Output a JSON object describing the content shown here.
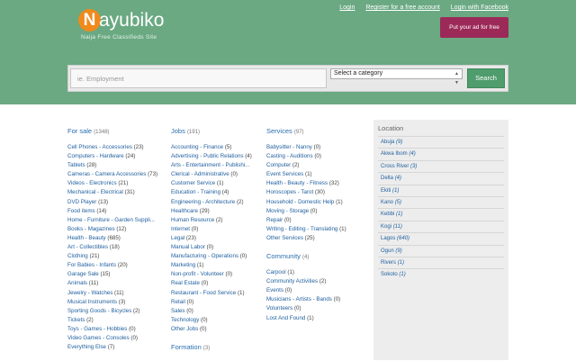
{
  "brand": {
    "initial": "N",
    "rest": "ayubiko",
    "tagline": "Naija Free Classifieds Site"
  },
  "top_links": {
    "login": "Login",
    "register": "Register for a free account",
    "facebook": "Login with Facebook"
  },
  "post_ad": "Put your ad for free",
  "search": {
    "placeholder": "ie. Employment",
    "category_value": "Select a category",
    "button": "Search"
  },
  "columns": [
    [
      {
        "title": "For sale",
        "count": "(1348)",
        "items": [
          {
            "name": "Cell Phones - Accessories",
            "count": "(23)"
          },
          {
            "name": "Computers - Hardware",
            "count": "(24)"
          },
          {
            "name": "Tablets",
            "count": "(28)"
          },
          {
            "name": "Cameras - Camera Accessories",
            "count": "(73)"
          },
          {
            "name": "Videos - Electronics",
            "count": "(21)"
          },
          {
            "name": "Mechanical - Electrical",
            "count": "(31)"
          },
          {
            "name": "DVD Player",
            "count": "(13)"
          },
          {
            "name": "Food items",
            "count": "(14)"
          },
          {
            "name": "Home - Furniture - Garden Suppli...",
            "count": ""
          },
          {
            "name": "Books - Magazines",
            "count": "(12)"
          },
          {
            "name": "Health - Beauty",
            "count": "(685)"
          },
          {
            "name": "Art - Collectibles",
            "count": "(18)"
          },
          {
            "name": "Clothing",
            "count": "(21)"
          },
          {
            "name": "For Babies - Infants",
            "count": "(20)"
          },
          {
            "name": "Garage Sale",
            "count": "(15)"
          },
          {
            "name": "Animals",
            "count": "(11)"
          },
          {
            "name": "Jewelry - Watches",
            "count": "(11)"
          },
          {
            "name": "Musical Instruments",
            "count": "(3)"
          },
          {
            "name": "Sporting Goods - Bicycles",
            "count": "(2)"
          },
          {
            "name": "Tickets",
            "count": "(2)"
          },
          {
            "name": "Toys - Games - Hobbies",
            "count": "(0)"
          },
          {
            "name": "Video Games - Consoles",
            "count": "(0)"
          },
          {
            "name": "Everything Else",
            "count": "(7)"
          }
        ]
      }
    ],
    [
      {
        "title": "Jobs",
        "count": "(191)",
        "items": [
          {
            "name": "Accounting - Finance",
            "count": "(5)"
          },
          {
            "name": "Advertising - Public Relations",
            "count": "(4)"
          },
          {
            "name": "Arts - Entertainment - Publishi...",
            "count": ""
          },
          {
            "name": "Clerical - Administrative",
            "count": "(0)"
          },
          {
            "name": "Customer Service",
            "count": "(1)"
          },
          {
            "name": "Education - Training",
            "count": "(4)"
          },
          {
            "name": "Engineering - Architecture",
            "count": "(2)"
          },
          {
            "name": "Healthcare",
            "count": "(29)"
          },
          {
            "name": "Human Resource",
            "count": "(2)"
          },
          {
            "name": "Internet",
            "count": "(0)"
          },
          {
            "name": "Legal",
            "count": "(23)"
          },
          {
            "name": "Manual Labor",
            "count": "(0)"
          },
          {
            "name": "Manufacturing - Operations",
            "count": "(0)"
          },
          {
            "name": "Marketing",
            "count": "(1)"
          },
          {
            "name": "Non-profit - Volunteer",
            "count": "(0)"
          },
          {
            "name": "Real Estate",
            "count": "(0)"
          },
          {
            "name": "Restaurant - Food Service",
            "count": "(1)"
          },
          {
            "name": "Retail",
            "count": "(0)"
          },
          {
            "name": "Sales",
            "count": "(0)"
          },
          {
            "name": "Technology",
            "count": "(0)"
          },
          {
            "name": "Other Jobs",
            "count": "(0)"
          }
        ]
      },
      {
        "title": "Formation",
        "count": "(3)",
        "items": []
      }
    ],
    [
      {
        "title": "Services",
        "count": "(97)",
        "items": [
          {
            "name": "Babysitter - Nanny",
            "count": "(0)"
          },
          {
            "name": "Casting - Auditions",
            "count": "(0)"
          },
          {
            "name": "Computer",
            "count": "(2)"
          },
          {
            "name": "Event Services",
            "count": "(1)"
          },
          {
            "name": "Health - Beauty - Fitness",
            "count": "(32)"
          },
          {
            "name": "Horoscopes - Tarot",
            "count": "(30)"
          },
          {
            "name": "Household - Domestic Help",
            "count": "(1)"
          },
          {
            "name": "Moving - Storage",
            "count": "(0)"
          },
          {
            "name": "Repair",
            "count": "(0)"
          },
          {
            "name": "Writing - Editing - Translating",
            "count": "(1)"
          },
          {
            "name": "Other Services",
            "count": "(25)"
          }
        ]
      },
      {
        "title": "Community",
        "count": "(4)",
        "items": [
          {
            "name": "Carpool",
            "count": "(1)"
          },
          {
            "name": "Community Activities",
            "count": "(2)"
          },
          {
            "name": "Events",
            "count": "(0)"
          },
          {
            "name": "Musicians - Artists - Bands",
            "count": "(0)"
          },
          {
            "name": "Volunteers",
            "count": "(0)"
          },
          {
            "name": "Lost And Found",
            "count": "(1)"
          }
        ]
      }
    ]
  ],
  "location": {
    "title": "Location",
    "items": [
      {
        "name": "Abuja",
        "count": "(9)"
      },
      {
        "name": "Akwa Ibom",
        "count": "(4)"
      },
      {
        "name": "Cross River",
        "count": "(3)"
      },
      {
        "name": "Delta",
        "count": "(4)"
      },
      {
        "name": "Ekiti",
        "count": "(1)"
      },
      {
        "name": "Kano",
        "count": "(5)"
      },
      {
        "name": "Kebbi",
        "count": "(1)"
      },
      {
        "name": "Kogi",
        "count": "(11)"
      },
      {
        "name": "Lagos",
        "count": "(640)"
      },
      {
        "name": "Ogun",
        "count": "(9)"
      },
      {
        "name": "Rivers",
        "count": "(1)"
      },
      {
        "name": "Sokoto",
        "count": "(1)"
      }
    ]
  }
}
